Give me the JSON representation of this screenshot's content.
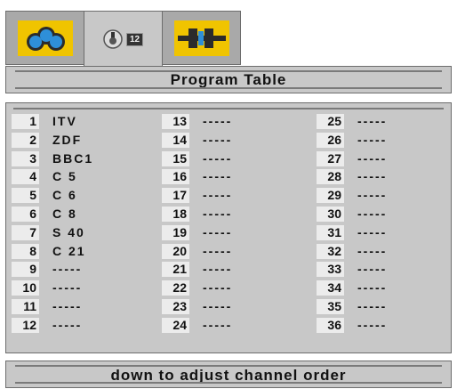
{
  "tabs": [
    {
      "icon": "picture-icon",
      "selected": false
    },
    {
      "icon": "setup-knob-icon",
      "badge": "12",
      "selected": true
    },
    {
      "icon": "connector-icon",
      "selected": false
    }
  ],
  "header": {
    "title": "Program Table"
  },
  "channels": [
    {
      "num": "1",
      "name": "ITV"
    },
    {
      "num": "2",
      "name": "ZDF"
    },
    {
      "num": "3",
      "name": "BBC1"
    },
    {
      "num": "4",
      "name": "C 5"
    },
    {
      "num": "5",
      "name": "C 6"
    },
    {
      "num": "6",
      "name": "C 8"
    },
    {
      "num": "7",
      "name": "S 40"
    },
    {
      "num": "8",
      "name": "C 21"
    },
    {
      "num": "9",
      "name": "-----"
    },
    {
      "num": "10",
      "name": "-----"
    },
    {
      "num": "11",
      "name": "-----"
    },
    {
      "num": "12",
      "name": "-----"
    },
    {
      "num": "13",
      "name": "-----"
    },
    {
      "num": "14",
      "name": "-----"
    },
    {
      "num": "15",
      "name": "-----"
    },
    {
      "num": "16",
      "name": "-----"
    },
    {
      "num": "17",
      "name": "-----"
    },
    {
      "num": "18",
      "name": "-----"
    },
    {
      "num": "19",
      "name": "-----"
    },
    {
      "num": "20",
      "name": "-----"
    },
    {
      "num": "21",
      "name": "-----"
    },
    {
      "num": "22",
      "name": "-----"
    },
    {
      "num": "23",
      "name": "-----"
    },
    {
      "num": "24",
      "name": "-----"
    },
    {
      "num": "25",
      "name": "-----"
    },
    {
      "num": "26",
      "name": "-----"
    },
    {
      "num": "27",
      "name": "-----"
    },
    {
      "num": "28",
      "name": "-----"
    },
    {
      "num": "29",
      "name": "-----"
    },
    {
      "num": "30",
      "name": "-----"
    },
    {
      "num": "31",
      "name": "-----"
    },
    {
      "num": "32",
      "name": "-----"
    },
    {
      "num": "33",
      "name": "-----"
    },
    {
      "num": "34",
      "name": "-----"
    },
    {
      "num": "35",
      "name": "-----"
    },
    {
      "num": "36",
      "name": "-----"
    }
  ],
  "footer": {
    "hint": "down to adjust channel order"
  }
}
